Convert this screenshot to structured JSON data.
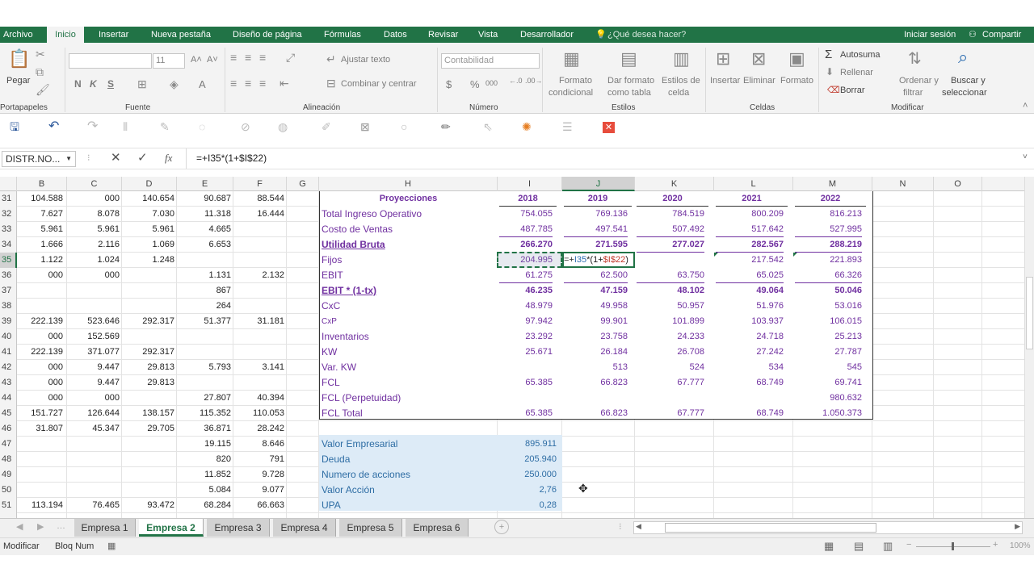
{
  "menu": {
    "tabs": [
      "Archivo",
      "Inicio",
      "Insertar",
      "Nueva pestaña",
      "Diseño de página",
      "Fórmulas",
      "Datos",
      "Revisar",
      "Vista",
      "Desarrollador"
    ],
    "tell_me": "¿Qué desea hacer?",
    "sign_in": "Iniciar sesión",
    "share": "Compartir"
  },
  "ribbon": {
    "paste": "Pegar",
    "font_size": "11",
    "bold": "N",
    "italic": "K",
    "underline": "S",
    "wrap_text": "Ajustar texto",
    "merge": "Combinar y centrar",
    "number_format": "Contabilidad",
    "currency": "$",
    "percent": "%",
    "thousands": "000",
    "cond_format_1": "Formato",
    "cond_format_2": "condicional",
    "format_table_1": "Dar formato",
    "format_table_2": "como tabla",
    "cell_styles_1": "Estilos de",
    "cell_styles_2": "celda",
    "insert": "Insertar",
    "delete": "Eliminar",
    "format": "Formato",
    "autosum": "Autosuma",
    "fill": "Rellenar",
    "clear": "Borrar",
    "sort_1": "Ordenar y",
    "sort_2": "filtrar",
    "find_1": "Buscar y",
    "find_2": "seleccionar",
    "groups": {
      "clipboard": "Portapapeles",
      "font": "Fuente",
      "alignment": "Alineación",
      "number": "Número",
      "styles": "Estilos",
      "cells": "Celdas",
      "editing": "Modificar"
    }
  },
  "formula_bar": {
    "name_box": "DISTR.NO...",
    "formula": "=+I35*(1+$I$22)"
  },
  "columns": [
    "B",
    "C",
    "D",
    "E",
    "F",
    "G",
    "H",
    "I",
    "J",
    "K",
    "L",
    "M",
    "N",
    "O"
  ],
  "rows": [
    "31",
    "32",
    "33",
    "34",
    "35",
    "36",
    "37",
    "38",
    "39",
    "40",
    "41",
    "42",
    "43",
    "44",
    "45",
    "46",
    "47",
    "48",
    "49",
    "50",
    "51"
  ],
  "left_values": [
    [
      "104.588",
      "000",
      "140.654",
      "90.687",
      "88.544"
    ],
    [
      "7.627",
      "8.078",
      "7.030",
      "11.318",
      "16.444"
    ],
    [
      "5.961",
      "5.961",
      "5.961",
      "4.665",
      ""
    ],
    [
      "1.666",
      "2.116",
      "1.069",
      "6.653",
      ""
    ],
    [
      "1.122",
      "1.024",
      "1.248",
      "",
      ""
    ],
    [
      "000",
      "000",
      "",
      "1.131",
      "2.132"
    ],
    [
      "",
      "",
      "",
      "867",
      ""
    ],
    [
      "",
      "",
      "",
      "264",
      ""
    ],
    [
      "222.139",
      "523.646",
      "292.317",
      "51.377",
      "31.181"
    ],
    [
      "000",
      "152.569",
      "",
      "",
      ""
    ],
    [
      "222.139",
      "371.077",
      "292.317",
      "",
      ""
    ],
    [
      "000",
      "9.447",
      "29.813",
      "5.793",
      "3.141"
    ],
    [
      "000",
      "9.447",
      "29.813",
      "",
      ""
    ],
    [
      "000",
      "000",
      "",
      "27.807",
      "40.394"
    ],
    [
      "151.727",
      "126.644",
      "138.157",
      "115.352",
      "110.053"
    ],
    [
      "31.807",
      "45.347",
      "29.705",
      "36.871",
      "28.242"
    ],
    [
      "",
      "",
      "",
      "19.115",
      "8.646"
    ],
    [
      "",
      "",
      "",
      "820",
      "791"
    ],
    [
      "",
      "",
      "",
      "11.852",
      "9.728"
    ],
    [
      "",
      "",
      "",
      "5.084",
      "9.077"
    ],
    [
      "113.194",
      "76.465",
      "93.472",
      "68.284",
      "66.663"
    ]
  ],
  "projections": {
    "title": "Proyecciones",
    "years": [
      "2018",
      "2019",
      "2020",
      "2021",
      "2022"
    ],
    "rows": [
      {
        "label": "Total Ingreso Operativo",
        "values": [
          "754.055",
          "769.136",
          "784.519",
          "800.209",
          "816.213"
        ]
      },
      {
        "label": "Costo de Ventas",
        "values": [
          "487.785",
          "497.541",
          "507.492",
          "517.642",
          "527.995"
        ]
      },
      {
        "label": "Utilidad Bruta",
        "values": [
          "266.270",
          "271.595",
          "277.027",
          "282.567",
          "288.219"
        ]
      },
      {
        "label": "Fijos",
        "values": [
          "204.995",
          "=+I35*(1+$I$22)",
          "",
          "217.542",
          "221.893"
        ]
      },
      {
        "label": "EBIT",
        "values": [
          "61.275",
          "62.500",
          "63.750",
          "65.025",
          "66.326"
        ]
      },
      {
        "label": "EBIT * (1-tx)",
        "values": [
          "46.235",
          "47.159",
          "48.102",
          "49.064",
          "50.046"
        ]
      },
      {
        "label": "CxC",
        "values": [
          "48.979",
          "49.958",
          "50.957",
          "51.976",
          "53.016"
        ]
      },
      {
        "label": "CxP",
        "values": [
          "97.942",
          "99.901",
          "101.899",
          "103.937",
          "106.015"
        ]
      },
      {
        "label": "Inventarios",
        "values": [
          "23.292",
          "23.758",
          "24.233",
          "24.718",
          "25.213"
        ]
      },
      {
        "label": "KW",
        "values": [
          "25.671",
          "26.184",
          "26.708",
          "27.242",
          "27.787"
        ]
      },
      {
        "label": "Var. KW",
        "values": [
          "",
          "513",
          "524",
          "534",
          "545"
        ]
      },
      {
        "label": "FCL",
        "values": [
          "65.385",
          "66.823",
          "67.777",
          "68.749",
          "69.741"
        ]
      },
      {
        "label": "FCL (Perpetuidad)",
        "values": [
          "",
          "",
          "",
          "",
          "980.632"
        ]
      },
      {
        "label": "FCL Total",
        "values": [
          "65.385",
          "66.823",
          "67.777",
          "68.749",
          "1.050.373"
        ]
      }
    ]
  },
  "valuation": [
    {
      "label": "Valor Empresarial",
      "value": "895.911"
    },
    {
      "label": "Deuda",
      "value": "205.940"
    },
    {
      "label": "Numero de acciones",
      "value": "250.000"
    },
    {
      "label": "Valor Acción",
      "value": "2,76"
    },
    {
      "label": "UPA",
      "value": "0,28"
    }
  ],
  "sheet_tabs": [
    "Empresa 1",
    "Empresa 2",
    "Empresa 3",
    "Empresa 4",
    "Empresa 5",
    "Empresa 6"
  ],
  "active_sheet": "Empresa 2",
  "status": {
    "mode": "Modificar",
    "numlock": "Bloq Num",
    "zoom": "100%"
  },
  "colors": {
    "excel_green": "#217346",
    "purple": "#7030a0",
    "valuation_fill": "#ddebf7"
  }
}
